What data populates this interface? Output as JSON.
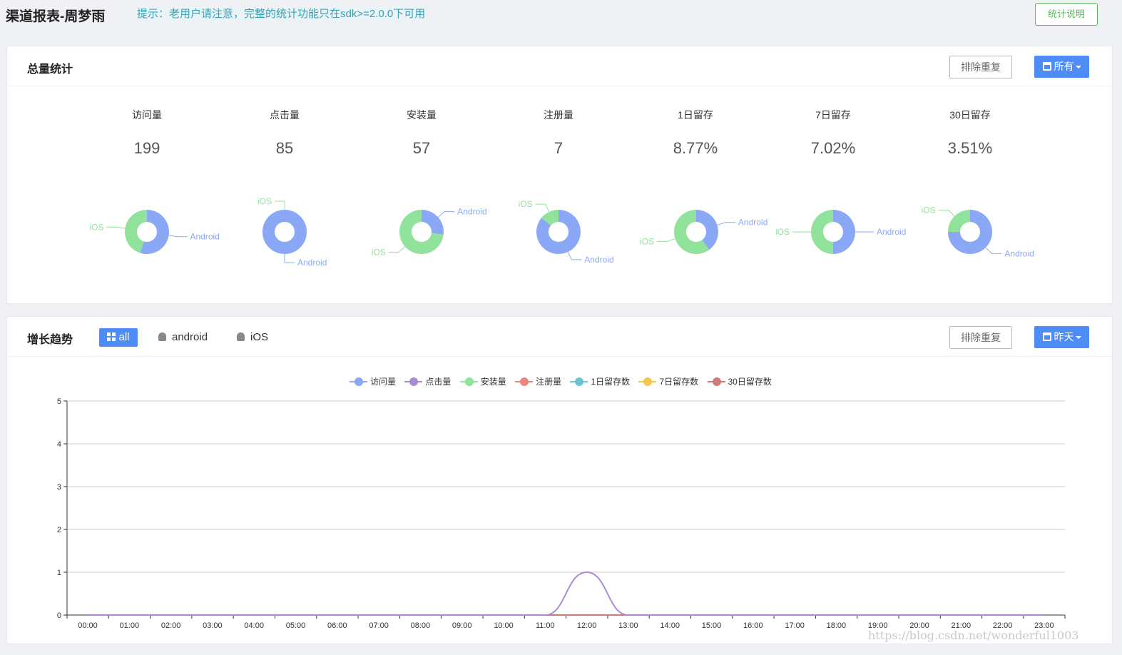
{
  "header": {
    "title": "渠道报表-周梦雨",
    "notice": "提示：老用户请注意，完整的统计功能只在sdk>=2.0.0下可用",
    "help_button": "统计说明"
  },
  "summary": {
    "title": "总量统计",
    "dedupe_button": "排除重复",
    "range_button": "所有",
    "stats": [
      {
        "label": "访问量",
        "value": "199",
        "ios_share": 0.45,
        "android_share": 0.55
      },
      {
        "label": "点击量",
        "value": "85",
        "ios_share": 0.0,
        "android_share": 1.0
      },
      {
        "label": "安装量",
        "value": "57",
        "ios_share": 0.73,
        "android_share": 0.27
      },
      {
        "label": "注册量",
        "value": "7",
        "ios_share": 0.14,
        "android_share": 0.86
      },
      {
        "label": "1日留存",
        "value": "8.77%",
        "ios_share": 0.6,
        "android_share": 0.4
      },
      {
        "label": "7日留存",
        "value": "7.02%",
        "ios_share": 0.5,
        "android_share": 0.5
      },
      {
        "label": "30日留存",
        "value": "3.51%",
        "ios_share": 0.25,
        "android_share": 0.75
      }
    ],
    "label_ios": "iOS",
    "label_android": "Android",
    "colors": {
      "ios": "#91e29a",
      "android": "#8aa8f5"
    }
  },
  "trend": {
    "title": "增长趋势",
    "dedupe_button": "排除重复",
    "range_button": "昨天",
    "tabs": {
      "all": "all",
      "android": "android",
      "ios": "iOS"
    },
    "legend": [
      {
        "name": "访问量",
        "color": "#8aa8f5"
      },
      {
        "name": "点击量",
        "color": "#a98ad6"
      },
      {
        "name": "安装量",
        "color": "#91e29a"
      },
      {
        "name": "注册量",
        "color": "#e9877e"
      },
      {
        "name": "1日留存数",
        "color": "#6cc3d1"
      },
      {
        "name": "7日留存数",
        "color": "#f1c74e"
      },
      {
        "name": "30日留存数",
        "color": "#d07a7a"
      }
    ]
  },
  "chart_data": {
    "type": "line",
    "x": [
      "00:00",
      "01:00",
      "02:00",
      "03:00",
      "04:00",
      "05:00",
      "06:00",
      "07:00",
      "08:00",
      "09:00",
      "10:00",
      "11:00",
      "12:00",
      "13:00",
      "14:00",
      "15:00",
      "16:00",
      "17:00",
      "18:00",
      "19:00",
      "20:00",
      "21:00",
      "22:00",
      "23:00"
    ],
    "ylim": [
      0,
      5
    ],
    "yticks": [
      "0",
      "1",
      "2",
      "3",
      "4",
      "5"
    ],
    "smooth": true,
    "series": [
      {
        "name": "访问量",
        "color": "#8aa8f5",
        "values": [
          0,
          0,
          0,
          0,
          0,
          0,
          0,
          0,
          0,
          0,
          0,
          0,
          0,
          0,
          0,
          0,
          0,
          0,
          0,
          0,
          0,
          0,
          0,
          0
        ]
      },
      {
        "name": "点击量",
        "color": "#a98ad6",
        "values": [
          0,
          0,
          0,
          0,
          0,
          0,
          0,
          0,
          0,
          0,
          0,
          0,
          1,
          0,
          0,
          0,
          0,
          0,
          0,
          0,
          0,
          0,
          0,
          0
        ]
      },
      {
        "name": "安装量",
        "color": "#91e29a",
        "values": [
          0,
          0,
          0,
          0,
          0,
          0,
          0,
          0,
          0,
          0,
          0,
          0,
          0,
          0,
          0,
          0,
          0,
          0,
          0,
          0,
          0,
          0,
          0,
          0
        ]
      },
      {
        "name": "注册量",
        "color": "#e9877e",
        "values": [
          0,
          0,
          0,
          0,
          0,
          0,
          0,
          0,
          0,
          0,
          0,
          0,
          0,
          0,
          0,
          0,
          0,
          0,
          0,
          0,
          0,
          0,
          0,
          0
        ]
      },
      {
        "name": "1日留存数",
        "color": "#6cc3d1",
        "values": [
          0,
          0,
          0,
          0,
          0,
          0,
          0,
          0,
          0,
          0,
          0,
          0,
          0,
          0,
          0,
          0,
          0,
          0,
          0,
          0,
          0,
          0,
          0,
          0
        ]
      },
      {
        "name": "7日留存数",
        "color": "#f1c74e",
        "values": [
          0,
          0,
          0,
          0,
          0,
          0,
          0,
          0,
          0,
          0,
          0,
          0,
          0,
          0,
          0,
          0,
          0,
          0,
          0,
          0,
          0,
          0,
          0,
          0
        ]
      },
      {
        "name": "30日留存数",
        "color": "#d07a7a",
        "values": [
          0,
          0,
          0,
          0,
          0,
          0,
          0,
          0,
          0,
          0,
          0,
          0,
          0,
          0,
          0,
          0,
          0,
          0,
          0,
          0,
          0,
          0,
          0,
          0
        ]
      }
    ]
  },
  "watermark": "https://blog.csdn.net/wonderful1003"
}
